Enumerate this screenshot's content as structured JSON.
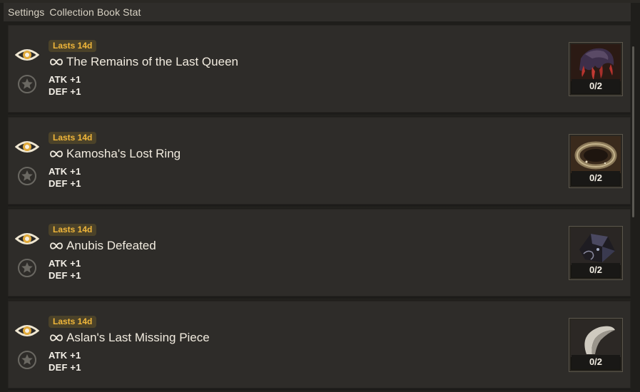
{
  "header": {
    "crumbs": [
      "Settings",
      "Collection Book Stat"
    ]
  },
  "colors": {
    "badge_text": "#f0b63a",
    "badge_bg": "#4b4229",
    "eye": "#efe7d2",
    "eye_pupil": "#e0a93a"
  },
  "items": [
    {
      "badge": "Lasts 14d",
      "icon": "infinity-icon",
      "name": "The Remains of the Last Queen",
      "stats": [
        "ATK +1",
        "DEF +1"
      ],
      "count": "0/2",
      "image": "dark-claw-relic"
    },
    {
      "badge": "Lasts 14d",
      "icon": "infinity-icon",
      "name": "Kamosha's Lost Ring",
      "stats": [
        "ATK +1",
        "DEF +1"
      ],
      "count": "0/2",
      "image": "ring"
    },
    {
      "badge": "Lasts 14d",
      "icon": "infinity-icon",
      "name": "Anubis Defeated",
      "stats": [
        "ATK +1",
        "DEF +1"
      ],
      "count": "0/2",
      "image": "dark-shard"
    },
    {
      "badge": "Lasts 14d",
      "icon": "infinity-icon",
      "name": "Aslan's Last Missing Piece",
      "stats": [
        "ATK +1",
        "DEF +1"
      ],
      "count": "0/2",
      "image": "horn-fang"
    }
  ]
}
